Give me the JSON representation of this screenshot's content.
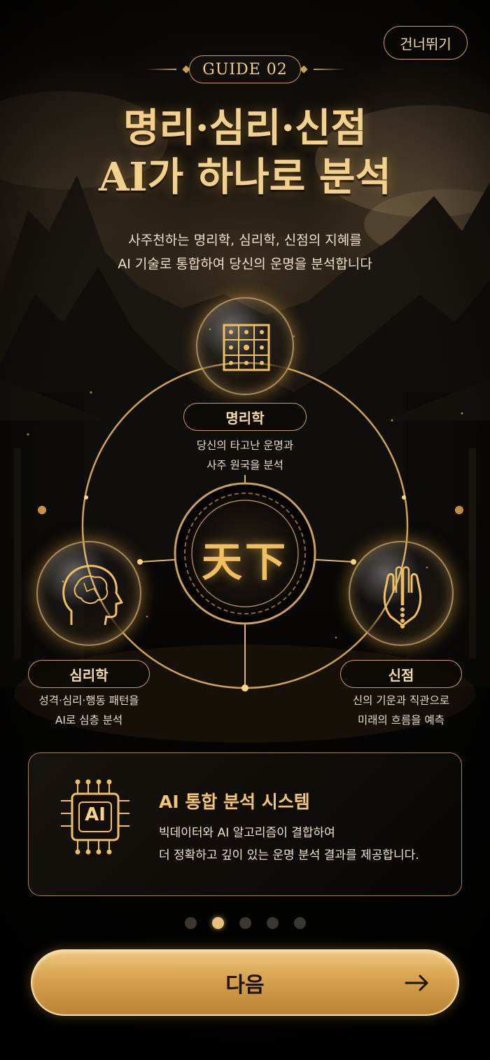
{
  "header": {
    "skip_label": "건너뛰기",
    "guide_label": "GUIDE 02",
    "title_line1": "명리·심리·신점",
    "title_line2": "AI가 하나로 분석",
    "subtitle_line1": "사주천하는 명리학, 심리학, 신점의 지혜를",
    "subtitle_line2": "AI 기술로 통합하여 당신의 운명을 분석합니다"
  },
  "diagram": {
    "center_text": "天下",
    "nodes": [
      {
        "key": "myeongri",
        "label": "명리학",
        "desc_line1": "당신의 타고난 운명과",
        "desc_line2": "사주 원국을 분석",
        "icon": "grid-icon"
      },
      {
        "key": "simri",
        "label": "심리학",
        "desc_line1": "성격·심리·행동 패턴을",
        "desc_line2": "AI로 심층 분석",
        "icon": "brain-head-icon"
      },
      {
        "key": "sinjeom",
        "label": "신점",
        "desc_line1": "신의 기운과 직관으로",
        "desc_line2": "미래의 흐름을 예측",
        "icon": "praying-hands-icon"
      }
    ]
  },
  "ai_card": {
    "chip_text": "AI",
    "title": "AI 통합 분석 시스템",
    "desc_line1": "빅데이터와 AI 알고리즘이 결합하여",
    "desc_line2": "더 정확하고 깊이 있는 운명 분석 결과를 제공합니다."
  },
  "pagination": {
    "total": 5,
    "active_index": 1
  },
  "next_button": {
    "label": "다음",
    "arrow": "→"
  },
  "colors": {
    "gold": "#c9a15a",
    "gold_light": "#f0cf8c",
    "background": "#050403",
    "button_gold": "#d6a04e"
  }
}
